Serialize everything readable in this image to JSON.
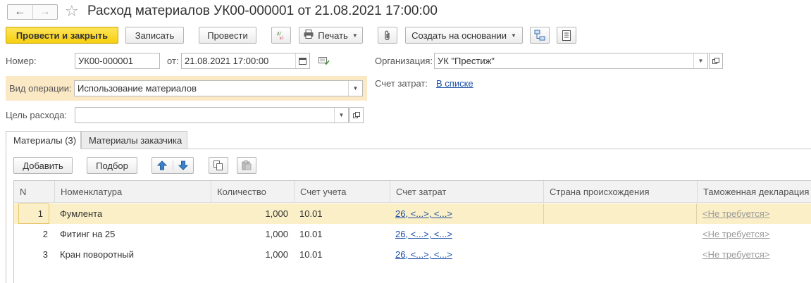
{
  "window": {
    "title": "Расход материалов УК00-000001 от 21.08.2021 17:00:00",
    "back_glyph": "🡐",
    "forward_glyph": "🡒",
    "star_glyph": "☆"
  },
  "toolbar": {
    "post_close": "Провести и закрыть",
    "save": "Записать",
    "post": "Провести",
    "dtkt_icon": "dt-kt-icon",
    "print": "Печать",
    "attach_icon": "paperclip-icon",
    "create_based": "Создать на основании",
    "structure_icon": "structure-icon",
    "report_icon": "report-icon"
  },
  "form": {
    "number_label": "Номер:",
    "number_value": "УК00-000001",
    "date_label": "от:",
    "date_value": "21.08.2021 17:00:00",
    "org_label": "Организация:",
    "org_value": "УК \"Престиж\"",
    "operation_label": "Вид операции:",
    "operation_value": "Использование материалов",
    "cost_account_label": "Счет затрат:",
    "cost_account_link": "В списке",
    "purpose_label": "Цель расхода:",
    "purpose_value": ""
  },
  "tabs": [
    {
      "label": "Материалы (3)",
      "active": true
    },
    {
      "label": "Материалы заказчика",
      "active": false
    }
  ],
  "table_toolbar": {
    "add": "Добавить",
    "pick": "Подбор"
  },
  "table": {
    "columns": [
      "N",
      "Номенклатура",
      "Количество",
      "Счет учета",
      "Счет затрат",
      "Страна происхождения",
      "Таможенная декларация"
    ],
    "rows": [
      {
        "n": "1",
        "item": "Фумлента",
        "qty": "1,000",
        "account": "10.01",
        "cost": "26, <...>, <...>",
        "country": "",
        "declaration": "<Не требуется>"
      },
      {
        "n": "2",
        "item": "Фитинг на 25",
        "qty": "1,000",
        "account": "10.01",
        "cost": "26, <...>, <...>",
        "country": "",
        "declaration": "<Не требуется>"
      },
      {
        "n": "3",
        "item": "Кран поворотный",
        "qty": "1,000",
        "account": "10.01",
        "cost": "26, <...>, <...>",
        "country": "",
        "declaration": "<Не требуется>"
      }
    ]
  },
  "colors": {
    "accent": "#f6cf0f",
    "operation_highlight": "#fbe9c6",
    "selected_row": "#fbefc7",
    "link": "#1a4ea5"
  }
}
